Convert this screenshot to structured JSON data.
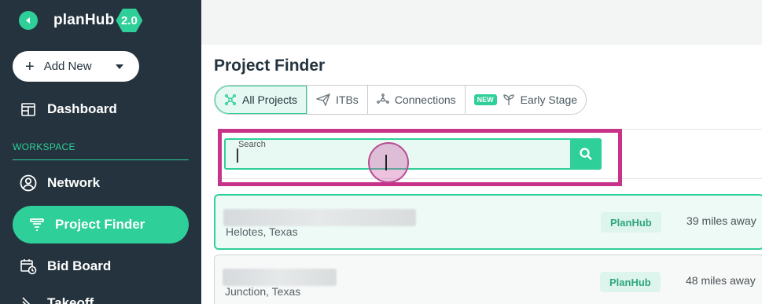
{
  "sidebar": {
    "brand": "planHub",
    "version": "2.0",
    "add_new": "Add New",
    "dashboard": "Dashboard",
    "workspace_label": "WORKSPACE",
    "items": [
      {
        "label": "Network",
        "icon": "user-circle-icon"
      },
      {
        "label": "Project Finder",
        "icon": "filter-funnel-icon"
      },
      {
        "label": "Bid Board",
        "icon": "calendar-clock-icon"
      },
      {
        "label": "Takeoff",
        "icon": "ruler-icon"
      }
    ],
    "accent": "#2fcf9a",
    "background": "#24333d"
  },
  "main": {
    "title": "Project Finder",
    "tabs": [
      {
        "label": "All Projects",
        "icon": "network-hub-icon",
        "active": true
      },
      {
        "label": "ITBs",
        "icon": "paper-plane-icon",
        "active": false
      },
      {
        "label": "Connections",
        "icon": "connections-icon",
        "active": false
      },
      {
        "label": "Early Stage",
        "icon": "sprout-icon",
        "badge": "NEW",
        "active": false
      }
    ],
    "search": {
      "label": "Search",
      "value": "",
      "placeholder": ""
    },
    "results": [
      {
        "location": "Helotes, Texas",
        "source": "PlanHub",
        "distance": "39 miles away"
      },
      {
        "location": "Junction, Texas",
        "source": "PlanHub",
        "distance": "48 miles away"
      }
    ]
  }
}
